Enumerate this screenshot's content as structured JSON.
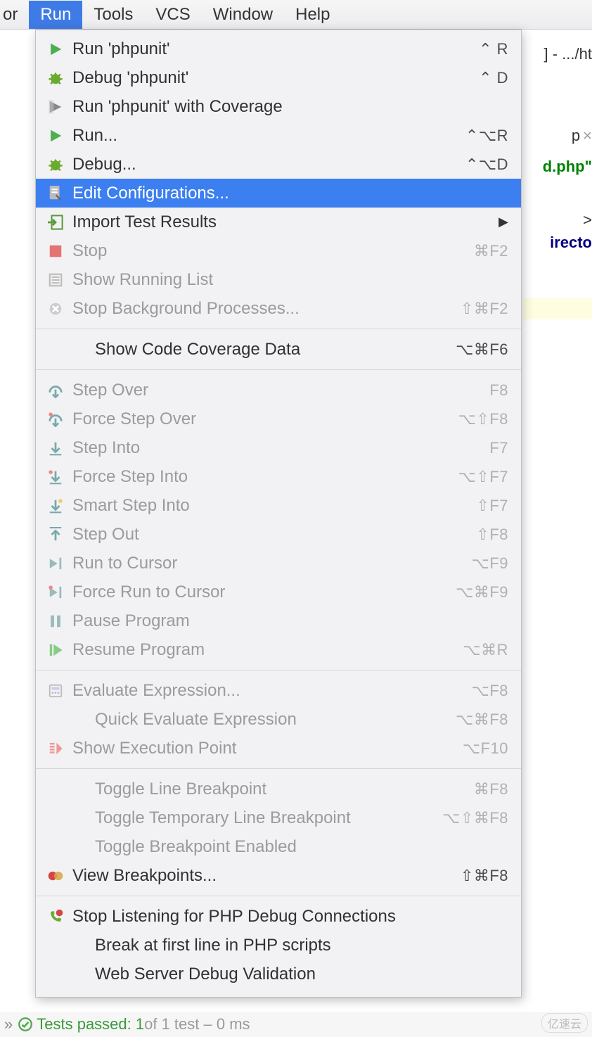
{
  "menubar": {
    "prefix": "or",
    "items": [
      "Run",
      "Tools",
      "VCS",
      "Window",
      "Help"
    ],
    "active_index": 0
  },
  "bg": {
    "tab_right": "] - .../ht",
    "tab2_p": "p",
    "php_code": "d.php\"",
    "arrow": ">",
    "text": "irecto"
  },
  "menu": {
    "groups": [
      [
        {
          "icon": "play-green",
          "label": "Run 'phpunit'",
          "shortcut": "⌃ R"
        },
        {
          "icon": "bug-green",
          "label": "Debug 'phpunit'",
          "shortcut": "⌃ D"
        },
        {
          "icon": "coverage",
          "label": "Run 'phpunit' with Coverage",
          "shortcut": ""
        },
        {
          "icon": "play-green",
          "label": "Run...",
          "shortcut": "⌃⌥R"
        },
        {
          "icon": "bug-green",
          "label": "Debug...",
          "shortcut": "⌃⌥D"
        },
        {
          "icon": "edit",
          "label": "Edit Configurations...",
          "shortcut": "",
          "selected": true
        },
        {
          "icon": "import",
          "label": "Import Test Results",
          "shortcut": "",
          "submenu": true
        },
        {
          "icon": "stop",
          "label": "Stop",
          "shortcut": "⌘F2",
          "disabled": true
        },
        {
          "icon": "list",
          "label": "Show Running List",
          "shortcut": "",
          "disabled": true
        },
        {
          "icon": "cancel",
          "label": "Stop Background Processes...",
          "shortcut": "⇧⌘F2",
          "disabled": true
        }
      ],
      [
        {
          "icon": "",
          "label": "Show Code Coverage Data",
          "shortcut": "⌥⌘F6",
          "noicon": true
        }
      ],
      [
        {
          "icon": "step-over",
          "label": "Step Over",
          "shortcut": "F8",
          "disabled": true
        },
        {
          "icon": "force-step-over",
          "label": "Force Step Over",
          "shortcut": "⌥⇧F8",
          "disabled": true
        },
        {
          "icon": "step-into",
          "label": "Step Into",
          "shortcut": "F7",
          "disabled": true
        },
        {
          "icon": "force-step-into",
          "label": "Force Step Into",
          "shortcut": "⌥⇧F7",
          "disabled": true
        },
        {
          "icon": "smart-step-into",
          "label": "Smart Step Into",
          "shortcut": "⇧F7",
          "disabled": true
        },
        {
          "icon": "step-out",
          "label": "Step Out",
          "shortcut": "⇧F8",
          "disabled": true
        },
        {
          "icon": "run-to-cursor",
          "label": "Run to Cursor",
          "shortcut": "⌥F9",
          "disabled": true
        },
        {
          "icon": "force-run-to-cursor",
          "label": "Force Run to Cursor",
          "shortcut": "⌥⌘F9",
          "disabled": true
        },
        {
          "icon": "pause",
          "label": "Pause Program",
          "shortcut": "",
          "disabled": true
        },
        {
          "icon": "resume",
          "label": "Resume Program",
          "shortcut": "⌥⌘R",
          "disabled": true
        }
      ],
      [
        {
          "icon": "calc",
          "label": "Evaluate Expression...",
          "shortcut": "⌥F8",
          "disabled": true
        },
        {
          "icon": "",
          "label": "Quick Evaluate Expression",
          "shortcut": "⌥⌘F8",
          "disabled": true,
          "noicon": true
        },
        {
          "icon": "exec-point",
          "label": "Show Execution Point",
          "shortcut": "⌥F10",
          "disabled": true
        }
      ],
      [
        {
          "icon": "",
          "label": "Toggle Line Breakpoint",
          "shortcut": "⌘F8",
          "disabled": true,
          "noicon": true
        },
        {
          "icon": "",
          "label": "Toggle Temporary Line Breakpoint",
          "shortcut": "⌥⇧⌘F8",
          "disabled": true,
          "noicon": true
        },
        {
          "icon": "",
          "label": "Toggle Breakpoint Enabled",
          "shortcut": "",
          "disabled": true,
          "noicon": true
        },
        {
          "icon": "breakpoints",
          "label": "View Breakpoints...",
          "shortcut": "⇧⌘F8"
        }
      ],
      [
        {
          "icon": "phone",
          "label": "Stop Listening for PHP Debug Connections",
          "shortcut": ""
        },
        {
          "icon": "",
          "label": "Break at first line in PHP scripts",
          "shortcut": "",
          "noicon": true
        },
        {
          "icon": "",
          "label": "Web Server Debug Validation",
          "shortcut": "",
          "noicon": true
        }
      ]
    ]
  },
  "status": {
    "passed": "Tests passed: 1",
    "rest": " of 1 test – 0 ms",
    "watermark": "亿速云"
  }
}
